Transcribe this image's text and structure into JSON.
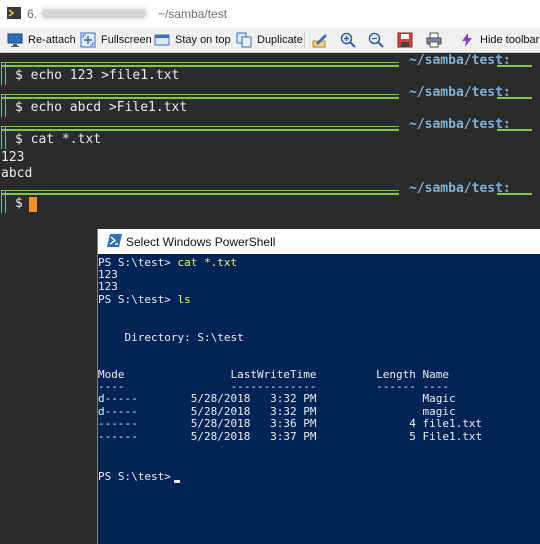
{
  "titlebar": {
    "number": "6.",
    "path": "~/samba/test"
  },
  "toolbar": {
    "items": [
      {
        "label": "Re-attach",
        "icon": "monitor-icon"
      },
      {
        "label": "Fullscreen",
        "icon": "fullscreen-icon"
      },
      {
        "label": "Stay on top",
        "icon": "pin-icon"
      },
      {
        "label": "Duplicate",
        "icon": "duplicate-icon"
      },
      {
        "label": "",
        "icon": "edit-icon"
      },
      {
        "label": "",
        "icon": "zoom-in-icon"
      },
      {
        "label": "",
        "icon": "zoom-out-icon"
      },
      {
        "label": "",
        "icon": "save-icon"
      },
      {
        "label": "",
        "icon": "print-icon"
      },
      {
        "label": "Hide toolbar",
        "icon": "lightning-icon"
      }
    ]
  },
  "terminal": {
    "prompt_path": "~/samba/test:",
    "prompt_symbol": "$",
    "commands": [
      "echo 123 >file1.txt",
      "echo abcd >File1.txt",
      "cat *.txt"
    ],
    "output": [
      "123",
      "abcd"
    ],
    "cursor_color": "#ef8f2a",
    "accent_color": "#7fc64a"
  },
  "powershell": {
    "title": "Select Windows PowerShell",
    "background": "#012456",
    "lines": {
      "p1_prompt": "PS S:\\test> ",
      "p1_cmd": "cat *.txt",
      "out1": "123",
      "out2": "123",
      "p2_prompt": "PS S:\\test> ",
      "p2_cmd": "ls",
      "dir": "    Directory: S:\\test",
      "header": "Mode                LastWriteTime         Length Name",
      "rule": "----                -------------         ------ ----",
      "rows": [
        "d-----        5/28/2018   3:32 PM                Magic",
        "d-----        5/28/2018   3:32 PM                magic",
        "------        5/28/2018   3:36 PM              4 file1.txt",
        "------        5/28/2018   3:37 PM              5 File1.txt"
      ],
      "p3_prompt": "PS S:\\test> "
    }
  }
}
